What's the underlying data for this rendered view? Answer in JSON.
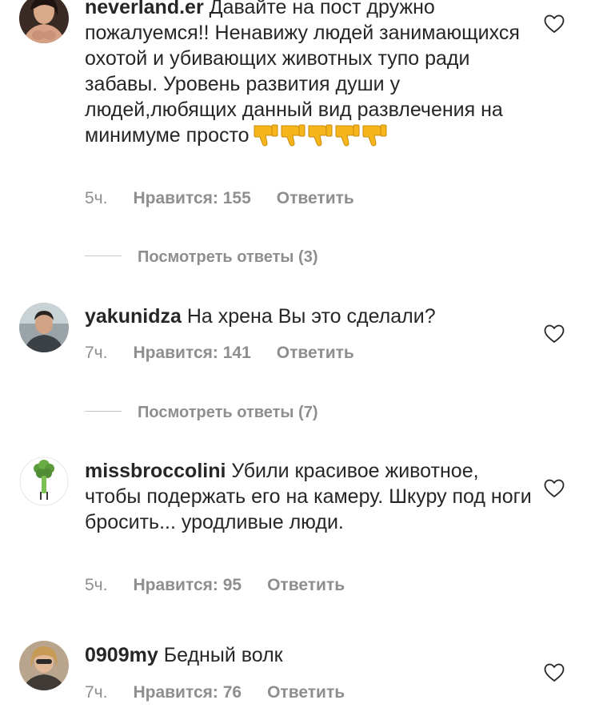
{
  "comments": [
    {
      "username": "neverland.er",
      "text": "Давайте на пост дружно пожалуемся!! Ненавижу людей занимающихся охотой и убивающих животных тупо ради забавы. Уровень развития души у людей,любящих данный вид развлечения на минимуме просто",
      "emoji": "thumbs-down x5",
      "time": "5ч.",
      "likes": "Нравится: 155",
      "reply": "Ответить",
      "view_replies": "Посмотреть ответы (3)"
    },
    {
      "username": "yakunidza",
      "text": "На хрена Вы это сделали?",
      "time": "7ч.",
      "likes": "Нравится: 141",
      "reply": "Ответить",
      "view_replies": "Посмотреть ответы (7)"
    },
    {
      "username": "missbroccolini",
      "text": "Убили красивое животное, чтобы подержать его на камеру. Шкуру под ноги бросить... уродливые люди.",
      "time": "5ч.",
      "likes": "Нравится: 95",
      "reply": "Ответить"
    },
    {
      "username": "0909my",
      "text": "Бедный волк",
      "time": "7ч.",
      "likes": "Нравится: 76",
      "reply": "Ответить"
    }
  ],
  "icons": {
    "like": "heart-outline-icon",
    "dislike": "thumbs-down-emoji"
  },
  "colors": {
    "text": "#262626",
    "secondary": "#8e8e8e",
    "divider": "#c7c7c7",
    "emoji": "#f7b51c"
  }
}
